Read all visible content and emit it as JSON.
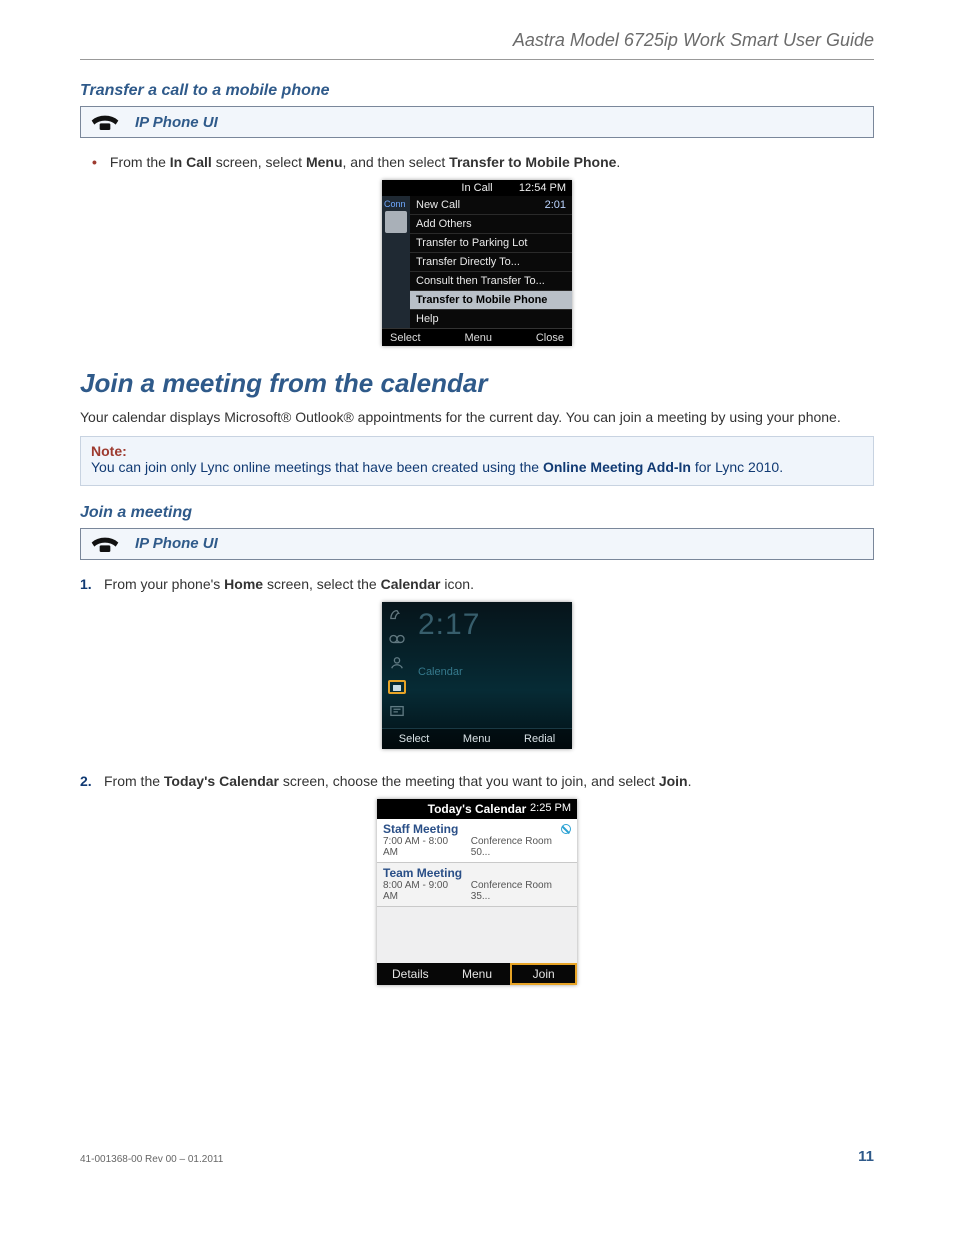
{
  "header_title": "Aastra Model 6725ip Work Smart User Guide",
  "section_transfer": {
    "title": "Transfer a call to a mobile phone",
    "ip_label": "IP Phone UI",
    "bullet": {
      "pre": "From the ",
      "b1": "In Call",
      "mid1": " screen, select ",
      "b2": "Menu",
      "mid2": ", and then select ",
      "b3": "Transfer to Mobile Phone",
      "post": "."
    }
  },
  "shot1": {
    "title": "In Call",
    "clock": "12:54 PM",
    "side_label": "Conn",
    "duration": "2:01",
    "items": [
      "New Call",
      "Add Others",
      "Transfer to Parking Lot",
      "Transfer Directly To...",
      "Consult then Transfer To...",
      "Transfer to Mobile Phone",
      "Help"
    ],
    "softkeys": [
      "Select",
      "Menu",
      "Close"
    ]
  },
  "h1": "Join a meeting from the calendar",
  "intro": "Your calendar displays Microsoft® Outlook® appointments for the current day. You can join a meeting by using your phone.",
  "note": {
    "label": "Note:",
    "pre": "You can join only Lync online meetings that have been created using the ",
    "bold": "Online Meeting Add-In",
    "post": " for Lync 2010."
  },
  "section_join": {
    "title": "Join a meeting",
    "ip_label": "IP Phone UI",
    "step1": {
      "num": "1.",
      "pre": "From your phone's ",
      "b1": "Home",
      "mid": " screen, select the ",
      "b2": "Calendar",
      "post": " icon."
    },
    "step2": {
      "num": "2.",
      "pre": "From the ",
      "b1": "Today's Calendar",
      "mid": " screen, choose the meeting that you want to join, and select ",
      "b2": "Join",
      "post": "."
    }
  },
  "shot2": {
    "time": "2:17",
    "label": "Calendar",
    "softkeys": [
      "Select",
      "Menu",
      "Redial"
    ]
  },
  "shot3": {
    "title": "Today's Calendar",
    "clock": "2:25 PM",
    "events": [
      {
        "name": "Staff Meeting",
        "time": "7:00 AM - 8:00 AM",
        "room": "Conference Room 50..."
      },
      {
        "name": "Team Meeting",
        "time": "8:00 AM - 9:00 AM",
        "room": "Conference Room 35..."
      }
    ],
    "softkeys": [
      "Details",
      "Menu",
      "Join"
    ]
  },
  "footer": {
    "rev": "41-001368-00 Rev 00  – 01.2011",
    "page": "11"
  }
}
